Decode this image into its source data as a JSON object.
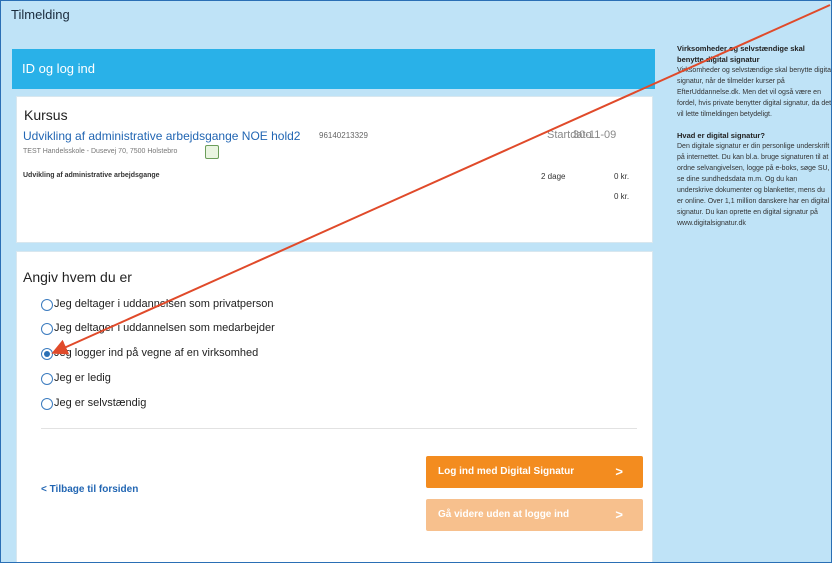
{
  "page": {
    "title": "Tilmelding"
  },
  "header": {
    "title": "ID og log ind"
  },
  "course": {
    "section_title": "Kursus",
    "name": "Udvikling af administrative arbejdsgange NOE hold2",
    "code": "96140213329",
    "address": "TEST Handelsskole - Dusevej 70, 7500 Holstebro",
    "start_label": "Startdato",
    "start_date": "30-11-09",
    "line_item": {
      "label": "Udvikling af administrative arbejdsgange",
      "duration": "2 dage",
      "price": "0 kr."
    },
    "total": "0 kr."
  },
  "identity": {
    "title": "Angiv hvem du er",
    "options": [
      {
        "label": "Jeg deltager i uddannelsen som privatperson",
        "checked": false
      },
      {
        "label": "Jeg deltager i uddannelsen som medarbejder",
        "checked": false
      },
      {
        "label": "Jeg logger ind på vegne af en virksomhed",
        "checked": true
      },
      {
        "label": "Jeg er ledig",
        "checked": false
      },
      {
        "label": "Jeg er selvstændig",
        "checked": false
      }
    ]
  },
  "actions": {
    "back_link": "< Tilbage til forsiden",
    "login_button": "Log ind med Digital Signatur",
    "continue_button": "Gå videre uden at logge ind",
    "chevron": ">"
  },
  "sidebar": {
    "heading1": "Virksomheder og selvstændige skal benytte digital signatur",
    "para1": "Virksomheder og selvstændige skal benytte digital signatur, når de tilmelder kurser på EfterUddannelse.dk. Men det vil også være en fordel, hvis private benytter digital signatur, da det vil lette tilmeldingen betydeligt.",
    "heading2": "Hvad er digital signatur?",
    "para2": "Den digitale signatur er din personlige underskrift på internettet. Du kan bl.a. bruge signaturen til at ordne selvangivelsen, logge på e-boks, søge SU, se dine sundhedsdata m.m. Og du kan underskrive dokumenter og blanketter, mens du er online. Over 1,1 million danskere har en digital signatur. Du kan oprette en digital signatur på",
    "link": "www.digitalsignatur.dk"
  },
  "colors": {
    "accent": "#29b1e8",
    "button_primary": "#f38c1f",
    "button_disabled": "#f7c08d",
    "arrow": "#e04a2a"
  }
}
